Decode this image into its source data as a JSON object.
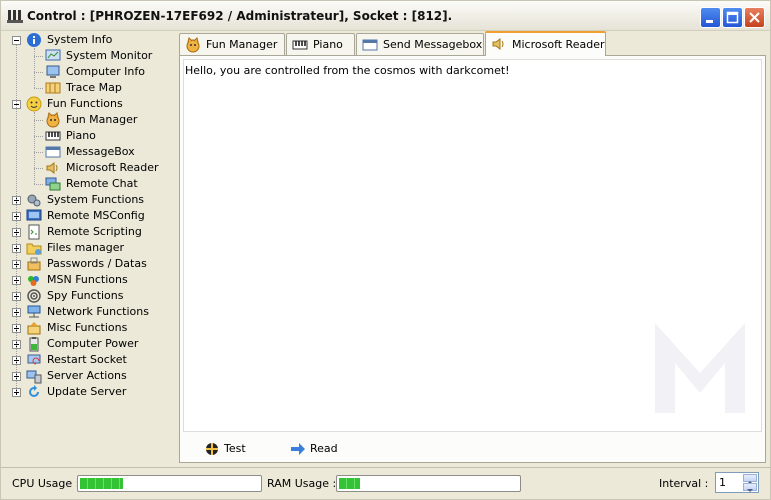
{
  "window": {
    "title": "Control : [PHROZEN-17EF692 / Administrateur], Socket : [812]."
  },
  "tree": {
    "items": [
      {
        "label": "System Info",
        "icon": "info-icon",
        "level": 0,
        "expander": "minus"
      },
      {
        "label": "System Monitor",
        "icon": "monitor-chart-icon",
        "level": 1
      },
      {
        "label": "Computer Info",
        "icon": "computer-info-icon",
        "level": 1
      },
      {
        "label": "Trace Map",
        "icon": "map-icon",
        "level": 1
      },
      {
        "label": "Fun Functions",
        "icon": "smiley-icon",
        "level": 0,
        "expander": "minus"
      },
      {
        "label": "Fun Manager",
        "icon": "cat-face-icon",
        "level": 1
      },
      {
        "label": "Piano",
        "icon": "piano-icon",
        "level": 1
      },
      {
        "label": "MessageBox",
        "icon": "message-box-icon",
        "level": 1
      },
      {
        "label": "Microsoft Reader",
        "icon": "speaker-icon",
        "level": 1
      },
      {
        "label": "Remote Chat",
        "icon": "chat-icon",
        "level": 1
      },
      {
        "label": "System Functions",
        "icon": "gears-icon",
        "level": 0,
        "expander": "plus"
      },
      {
        "label": "Remote MSConfig",
        "icon": "msconfig-icon",
        "level": 0,
        "expander": "plus"
      },
      {
        "label": "Remote Scripting",
        "icon": "script-icon",
        "level": 0,
        "expander": "plus"
      },
      {
        "label": "Files manager",
        "icon": "folder-icon",
        "level": 0,
        "expander": "plus"
      },
      {
        "label": "Passwords / Datas",
        "icon": "key-icon",
        "level": 0,
        "expander": "plus"
      },
      {
        "label": "MSN Functions",
        "icon": "msn-icon",
        "level": 0,
        "expander": "plus"
      },
      {
        "label": "Spy Functions",
        "icon": "spy-icon",
        "level": 0,
        "expander": "plus"
      },
      {
        "label": "Network Functions",
        "icon": "network-icon",
        "level": 0,
        "expander": "plus"
      },
      {
        "label": "Misc Functions",
        "icon": "misc-icon",
        "level": 0,
        "expander": "plus"
      },
      {
        "label": "Computer Power",
        "icon": "battery-icon",
        "level": 0,
        "expander": "plus"
      },
      {
        "label": "Restart Socket",
        "icon": "restart-icon",
        "level": 0,
        "expander": "plus"
      },
      {
        "label": "Server Actions",
        "icon": "server-icon",
        "level": 0,
        "expander": "plus"
      },
      {
        "label": "Update Server",
        "icon": "update-icon",
        "level": 0,
        "expander": "plus"
      }
    ]
  },
  "tabs": [
    {
      "label": "Fun Manager",
      "icon": "cat-face-icon",
      "active": false
    },
    {
      "label": "Piano",
      "icon": "piano-icon",
      "active": false
    },
    {
      "label": "Send Messagebox",
      "icon": "message-box-icon",
      "active": false
    },
    {
      "label": "Microsoft Reader",
      "icon": "speaker-icon",
      "active": true
    }
  ],
  "reader": {
    "text": "Hello, you are controlled from the cosmos with darkcomet!",
    "test_label": "Test",
    "read_label": "Read"
  },
  "status": {
    "cpu_label": "CPU Usage :",
    "cpu_fraction": 0.24,
    "ram_label": "RAM Usage :",
    "ram_fraction": 0.12,
    "interval_label": "Interval :",
    "interval_value": "1",
    "progress_color": "#34c334"
  }
}
